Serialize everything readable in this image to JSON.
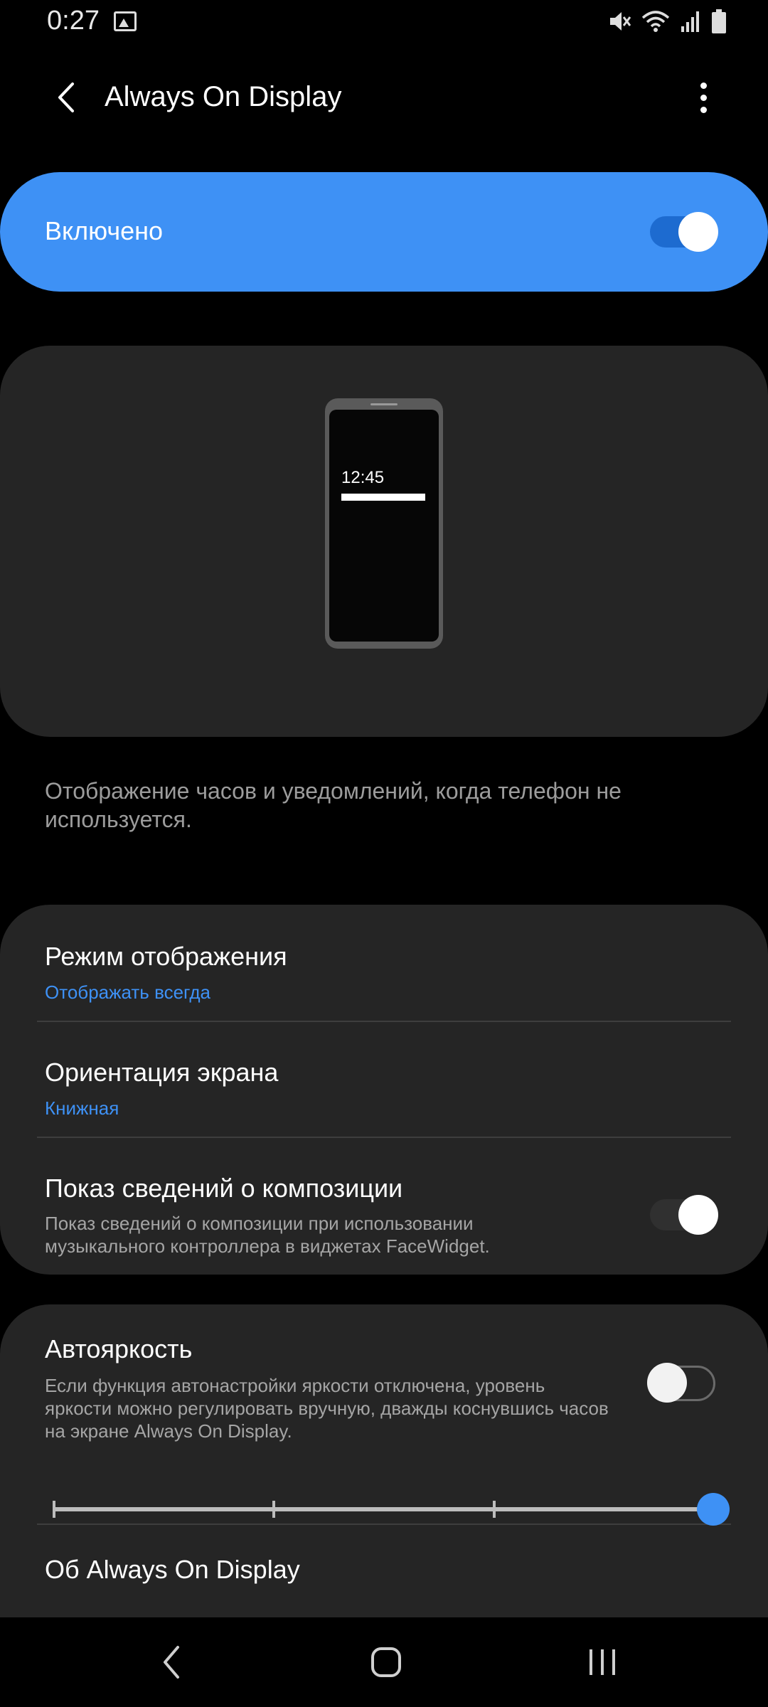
{
  "status_bar": {
    "time": "0:27",
    "icons": [
      "image-icon",
      "mute-icon",
      "wifi-icon",
      "signal-icon",
      "battery-icon"
    ]
  },
  "app_bar": {
    "title": "Always On Display",
    "back_icon": "chevron-left-icon",
    "more_icon": "more-vertical-icon"
  },
  "master_switch": {
    "label": "Включено",
    "on": true
  },
  "preview": {
    "clock": "12:45"
  },
  "description": "Отображение часов и уведомлений, когда телефон не используется.",
  "settings": {
    "display_mode": {
      "title": "Режим отображения",
      "value": "Отображать всегда"
    },
    "orientation": {
      "title": "Ориентация экрана",
      "value": "Книжная"
    },
    "music_info": {
      "title": "Показ сведений о композиции",
      "description": "Показ сведений о композиции при использовании музыкального контроллера в виджетах FaceWidget.",
      "on": false
    },
    "auto_brightness": {
      "title": "Автояркость",
      "description": "Если функция автонастройки яркости отключена, уровень яркости можно регулировать вручную, дважды коснувшись часов на экране Always On Display.",
      "on": false
    },
    "brightness_level": 1.0,
    "about": {
      "title": "Об Always On Display"
    }
  },
  "colors": {
    "accent": "#3e91f5",
    "card_bg": "#252525",
    "background": "#000000"
  },
  "nav_bar": {
    "icons": [
      "nav-back-icon",
      "nav-home-icon",
      "nav-recents-icon"
    ]
  }
}
